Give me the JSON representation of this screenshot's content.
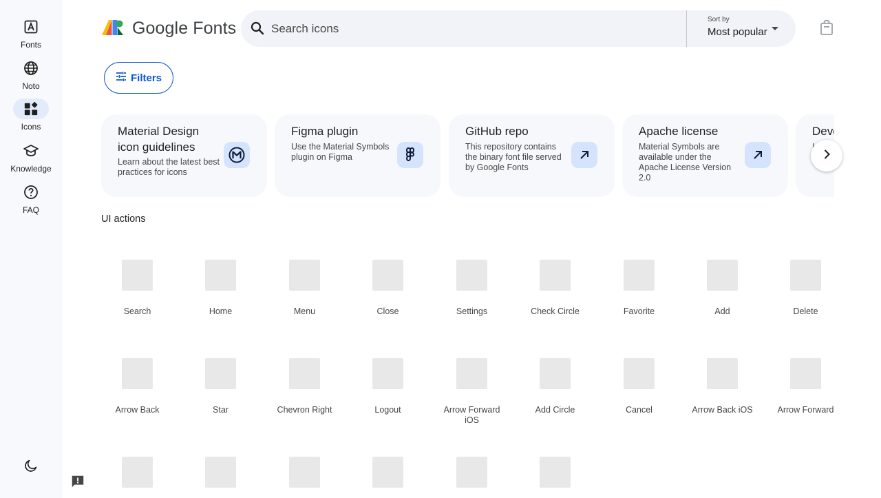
{
  "rail": {
    "items": [
      {
        "label": "Fonts",
        "icon": "font-icon"
      },
      {
        "label": "Noto",
        "icon": "globe-icon"
      },
      {
        "label": "Icons",
        "icon": "widgets-icon",
        "active": true
      },
      {
        "label": "Knowledge",
        "icon": "school-icon"
      },
      {
        "label": "FAQ",
        "icon": "help-icon"
      }
    ],
    "theme_toggle": "dark-mode-icon",
    "feedback": "feedback-icon"
  },
  "header": {
    "logo_text": "Google Fonts",
    "search_placeholder": "Search icons",
    "sort_caption": "Sort by",
    "sort_value": "Most popular",
    "bag_icon": "shopping-bag-icon"
  },
  "filters": {
    "label": "Filters"
  },
  "cards": [
    {
      "title": "Material Design icon guidelines",
      "desc": "Learn about the latest best practices for icons"
    },
    {
      "title": "Figma plugin",
      "desc": "Use the Material Symbols plugin on Figma"
    },
    {
      "title": "GitHub repo",
      "desc": "This repository contains the binary font file served by Google Fonts"
    },
    {
      "title": "Apache license",
      "desc": "Material Symbols are available under the Apache License Version 2.0"
    },
    {
      "title": "Deve",
      "desc": "I"
    }
  ],
  "section": {
    "title": "UI actions"
  },
  "icons": [
    "Search",
    "Home",
    "Menu",
    "Close",
    "Settings",
    "Check Circle",
    "Favorite",
    "Add",
    "Delete",
    "Arrow Back",
    "Star",
    "Chevron Right",
    "Logout",
    "Arrow Forward iOS",
    "Add Circle",
    "Cancel",
    "Arrow Back iOS",
    "Arrow Forward",
    "",
    "",
    "",
    "",
    "",
    ""
  ],
  "colors": {
    "accent": "#0b57d0",
    "rail_bg": "#f8f9fc",
    "search_bg": "#f1f3f8",
    "card_bg": "#f6f8fc",
    "card_icon_bg": "#d6e3fc"
  }
}
